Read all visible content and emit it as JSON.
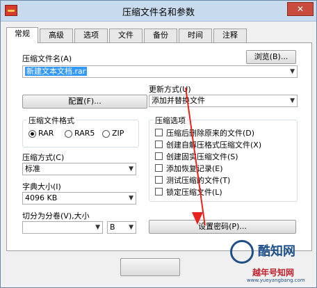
{
  "window": {
    "title": "压缩文件名和参数"
  },
  "tabs": [
    "常规",
    "高级",
    "选项",
    "文件",
    "备份",
    "时间",
    "注释"
  ],
  "archive": {
    "label": "压缩文件名(A)",
    "browse": "浏览(B)...",
    "value": "新建文本文档.rar"
  },
  "update": {
    "label": "更新方式(U)",
    "value": "添加并替换文件"
  },
  "profiles_button": "配置(F)...",
  "format": {
    "label": "压缩文件格式",
    "options": [
      "RAR",
      "RAR5",
      "ZIP"
    ],
    "selected": "RAR"
  },
  "compression": {
    "label": "压缩方式(C)",
    "value": "标准"
  },
  "dictionary": {
    "label": "字典大小(I)",
    "value": "4096 KB"
  },
  "split": {
    "label": "切分为分卷(V),大小",
    "unit": "B"
  },
  "options": {
    "label": "压缩选项",
    "items": [
      "压缩后删除原来的文件(D)",
      "创建自解压格式压缩文件(X)",
      "创建固实压缩文件(S)",
      "添加恢复记录(E)",
      "测试压缩的文件(T)",
      "锁定压缩文件(L)"
    ]
  },
  "password_button": "设置密码(P)...",
  "watermark": {
    "brand": "酷知网",
    "url": "www.yueyangbang.com",
    "sub": "越年号知网"
  }
}
